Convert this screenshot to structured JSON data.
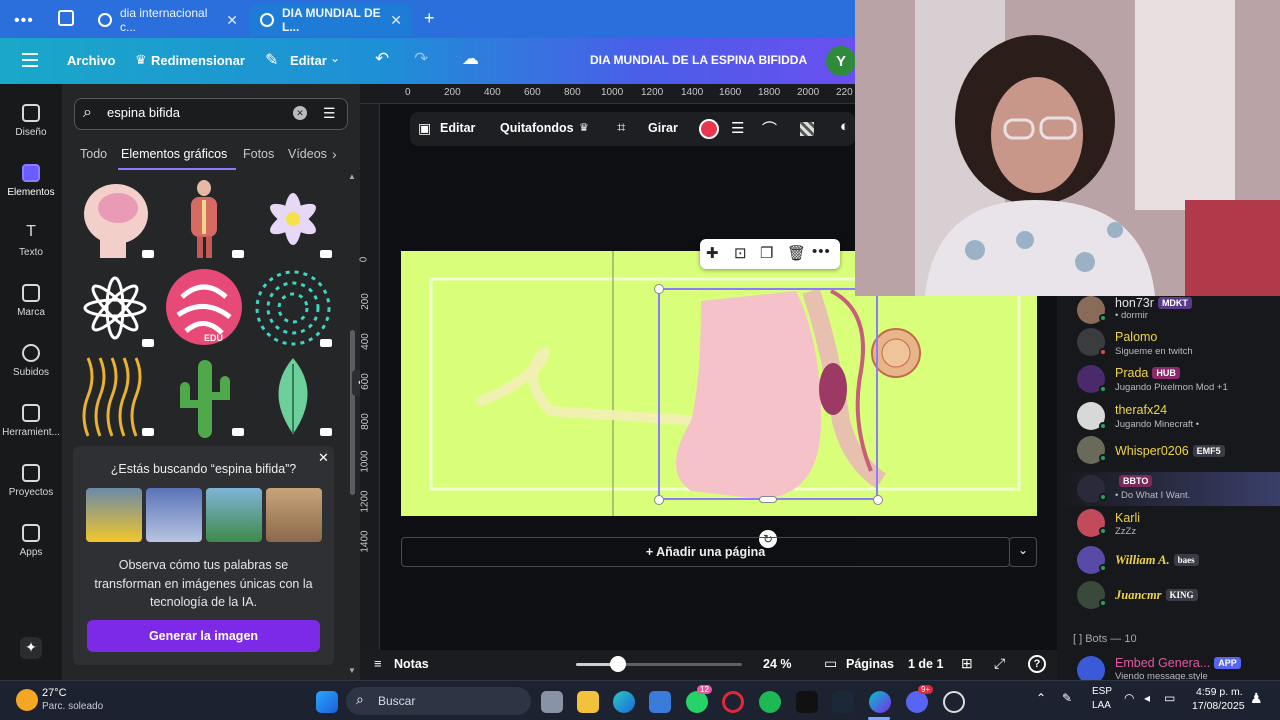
{
  "browser": {
    "tabs": [
      {
        "label": "dia internacional c..."
      },
      {
        "label": "DIA MUNDIAL DE L..."
      }
    ]
  },
  "toolbar": {
    "archivo": "Archivo",
    "redimensionar": "Redimensionar",
    "editar": "Editar",
    "doc_title": "DIA MUNDIAL DE LA ESPINA BIFIDDA",
    "avatar_letter": "Y"
  },
  "rail": {
    "items": [
      "Diseño",
      "Elementos",
      "Texto",
      "Marca",
      "Subidos",
      "Herramient...",
      "Proyectos",
      "Apps"
    ]
  },
  "panel": {
    "search_value": "espina bifida",
    "tabs": [
      "Todo",
      "Elementos gráficos",
      "Fotos",
      "Vídeos"
    ],
    "edu_label": "EDU",
    "promo": {
      "title": "¿Estás buscando “espina bifida”?",
      "body": "Observa cómo tus palabras se transforman en imágenes únicas con la tecnología de la IA.",
      "button": "Generar la imagen"
    }
  },
  "ruler": {
    "top": [
      "0",
      "200",
      "400",
      "600",
      "800",
      "1000",
      "1200",
      "1400",
      "1600",
      "1800",
      "2000",
      "220"
    ],
    "left": [
      "0",
      "200",
      "400",
      "600",
      "800",
      "1000",
      "1200",
      "1400"
    ]
  },
  "context": {
    "editar": "Editar",
    "quitafondos": "Quitafondos",
    "girar": "Girar",
    "color": "#e8364f"
  },
  "canvas": {
    "add_page": "+ Añadir una página",
    "bg_color": "#d9ff7a"
  },
  "bottom": {
    "notas": "Notas",
    "zoom": "24 %",
    "zoom_level": 0.25,
    "paginas": "Páginas",
    "page_count": "1 de 1"
  },
  "chat": {
    "users": [
      {
        "name": "hon73r",
        "badge": "MDKT",
        "status": "• dormir",
        "color": "#e4e4ea"
      },
      {
        "name": "Palomo",
        "badge": "",
        "status": "Sigueme en twitch",
        "color": "#f0d44a"
      },
      {
        "name": "Prada",
        "badge": "HUB",
        "status": "Jugando Pixelmon Mod +1",
        "color": "#f0d44a"
      },
      {
        "name": "therafx24",
        "badge": "",
        "status": "Jugando Minecraft •",
        "color": "#f0d44a"
      },
      {
        "name": "Whisper0206",
        "badge": "EMF5",
        "status": "",
        "color": "#f0d44a"
      },
      {
        "name": "",
        "badge": "BBTO",
        "status": "• Do What I Want.",
        "color": "#f0d44a"
      },
      {
        "name": "Karli",
        "badge": "",
        "status": "ZzZz",
        "color": "#f0d44a"
      },
      {
        "name": "William A.",
        "badge": "baes",
        "status": "",
        "color": "#f0d44a"
      },
      {
        "name": "Juancmr",
        "badge": "KING",
        "status": "",
        "color": "#f0d44a"
      }
    ],
    "bots_header": "[ ] Bots — 10",
    "bot": {
      "name": "Embed Genera...",
      "badge": "APP",
      "status": "Viendo message.style"
    }
  },
  "taskbar": {
    "temp": "27°C",
    "weather": "Parc. soleado",
    "search": "Buscar",
    "lang1": "ESP",
    "lang2": "LAA",
    "time": "4:59 p. m.",
    "date": "17/08/2025",
    "badge_whatsapp": "12",
    "badge_discord": "9+"
  }
}
